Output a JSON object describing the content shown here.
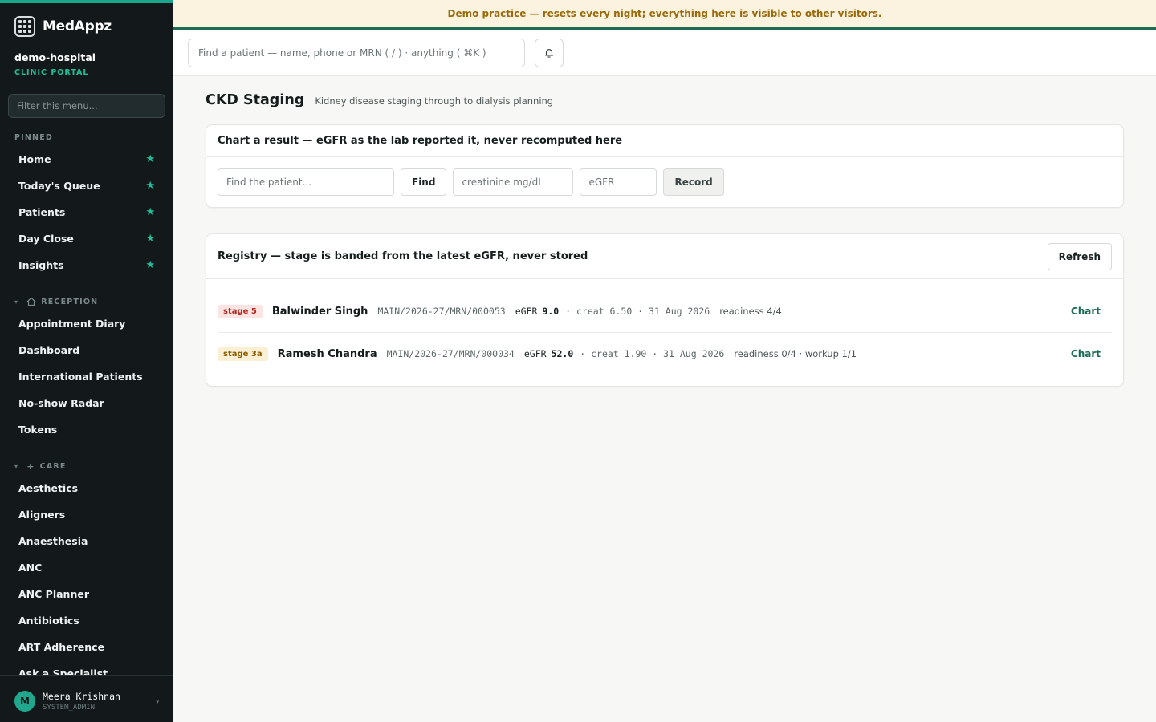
{
  "brand": {
    "name": "MedAppz"
  },
  "tenant": {
    "name": "demo-hospital",
    "portal": "CLINIC PORTAL"
  },
  "sidebar": {
    "filter_placeholder": "Filter this menu...",
    "pinned_label": "PINNED",
    "pinned": [
      {
        "label": "Home"
      },
      {
        "label": "Today's Queue"
      },
      {
        "label": "Patients"
      },
      {
        "label": "Day Close"
      },
      {
        "label": "Insights"
      }
    ],
    "reception_label": "RECEPTION",
    "reception": [
      {
        "label": "Appointment Diary"
      },
      {
        "label": "Dashboard"
      },
      {
        "label": "International Patients"
      },
      {
        "label": "No-show Radar"
      },
      {
        "label": "Tokens"
      }
    ],
    "care_label": "CARE",
    "care": [
      {
        "label": "Aesthetics"
      },
      {
        "label": "Aligners"
      },
      {
        "label": "Anaesthesia"
      },
      {
        "label": "ANC"
      },
      {
        "label": "ANC Planner"
      },
      {
        "label": "Antibiotics"
      },
      {
        "label": "ART Adherence"
      },
      {
        "label": "Ask a Specialist"
      }
    ],
    "star_glyph": "★"
  },
  "user": {
    "initial": "M",
    "name": "Meera Krishnan",
    "role": "SYSTEM_ADMIN"
  },
  "banner": {
    "text": "Demo practice — resets every night; everything here is visible to other visitors."
  },
  "topbar": {
    "search_placeholder": "Find a patient — name, phone or MRN ( / ) · anything ( ⌘K )"
  },
  "page": {
    "title": "CKD Staging",
    "subtitle": "Kidney disease staging through to dialysis planning"
  },
  "chart_card": {
    "title": "Chart a result — eGFR as the lab reported it, never recomputed here",
    "patient_placeholder": "Find the patient...",
    "find_label": "Find",
    "creatinine_placeholder": "creatinine mg/dL",
    "egfr_placeholder": "eGFR",
    "record_label": "Record"
  },
  "registry": {
    "title": "Registry — stage is banded from the latest eGFR, never stored",
    "refresh_label": "Refresh",
    "rows": [
      {
        "stage": "stage 5",
        "name": "Balwinder Singh",
        "mrn": "MAIN/2026-27/MRN/000053",
        "egfr_label": "eGFR",
        "egfr": "9.0",
        "meta": "· creat 6.50 · 31 Aug 2026",
        "readiness": "readiness 4/4",
        "action": "Chart"
      },
      {
        "stage": "stage 3a",
        "name": "Ramesh Chandra",
        "mrn": "MAIN/2026-27/MRN/000034",
        "egfr_label": "eGFR",
        "egfr": "52.0",
        "meta": "· creat 1.90 · 31 Aug 2026",
        "readiness": "readiness 0/4 · workup 1/1",
        "action": "Chart"
      }
    ]
  },
  "colors": {
    "accent": "#1fbf98",
    "brand_dark": "#1b6b55",
    "sidebar_bg": "#13191b",
    "banner_bg": "#fbf3df",
    "banner_text": "#9a6a08"
  }
}
